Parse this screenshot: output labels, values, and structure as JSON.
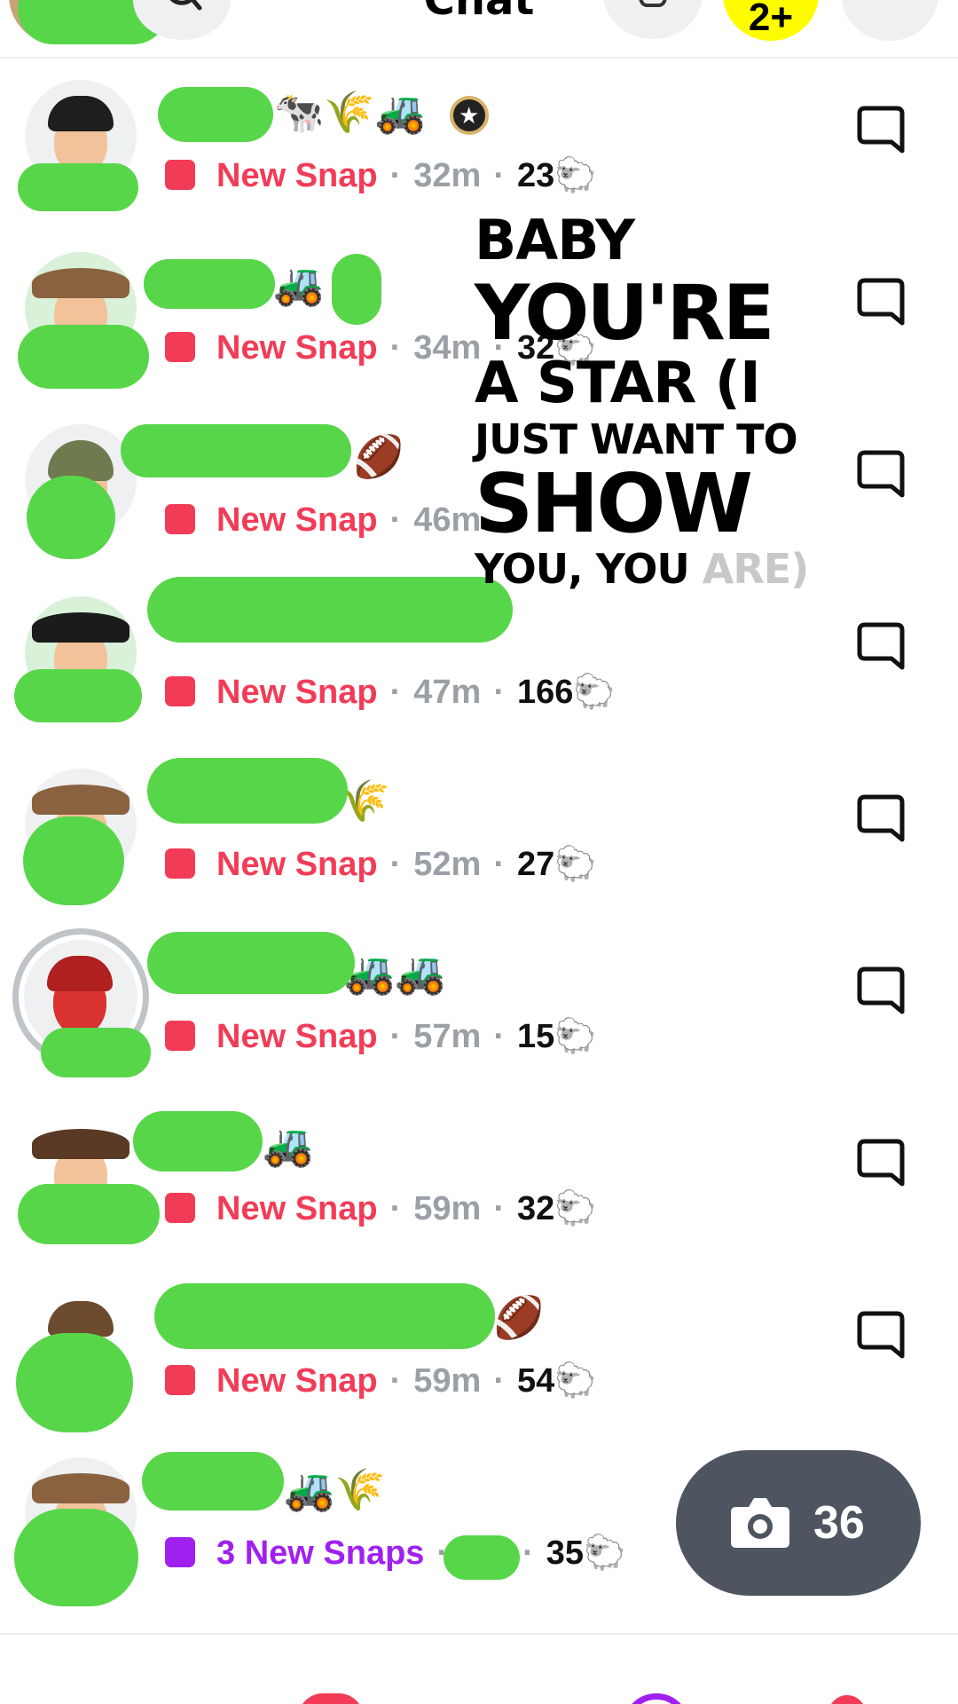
{
  "header": {
    "title": "Chat",
    "add_friends_label": "2+"
  },
  "chats": [
    {
      "name_emoji": "🐄🌾🚜",
      "has_badge": true,
      "status": "New Snap",
      "time": "32m",
      "streak": "23",
      "streak_emoji": "🐑",
      "snap_color": "red"
    },
    {
      "name_emoji": "🚜",
      "has_badge": false,
      "status": "New Snap",
      "time": "34m",
      "streak": "32",
      "streak_emoji": "🐑",
      "snap_color": "red"
    },
    {
      "name_emoji": "🏈",
      "has_badge": false,
      "status": "New Snap",
      "time": "46m",
      "streak": "",
      "streak_emoji": "🐑",
      "snap_color": "red"
    },
    {
      "name_emoji": "",
      "has_badge": false,
      "status": "New Snap",
      "time": "47m",
      "streak": "166",
      "streak_emoji": "🐑",
      "snap_color": "red"
    },
    {
      "name_emoji": "🌾",
      "has_badge": false,
      "status": "New Snap",
      "time": "52m",
      "streak": "27",
      "streak_emoji": "🐑",
      "snap_color": "red"
    },
    {
      "name_emoji": "🚜🚜",
      "has_badge": false,
      "status": "New Snap",
      "time": "57m",
      "streak": "15",
      "streak_emoji": "🐑",
      "snap_color": "red"
    },
    {
      "name_emoji": "🚜",
      "has_badge": false,
      "status": "New Snap",
      "time": "59m",
      "streak": "32",
      "streak_emoji": "🐑",
      "snap_color": "red"
    },
    {
      "name_emoji": "🏈",
      "has_badge": false,
      "status": "New Snap",
      "time": "59m",
      "streak": "54",
      "streak_emoji": "🐑",
      "snap_color": "red"
    },
    {
      "name_emoji": "🚜🌾",
      "has_badge": false,
      "status": "3 New Snaps",
      "time": "",
      "streak": "35",
      "streak_emoji": "🐑",
      "snap_color": "purple"
    }
  ],
  "overlay_text": {
    "line1": "BABY",
    "line2": "YOU'RE",
    "line3": "A STAR (I",
    "line4": "JUST WANT TO",
    "line5": "SHOW",
    "line6": "YOU, YOU",
    "line6_faded": "ARE)"
  },
  "camera": {
    "count": "36"
  },
  "colors": {
    "snap_red": "#f23c57",
    "snap_purple": "#a020f0",
    "scribble_green": "#57d64a",
    "camera_bg": "#4e5560",
    "add_yellow": "#fffc00"
  }
}
